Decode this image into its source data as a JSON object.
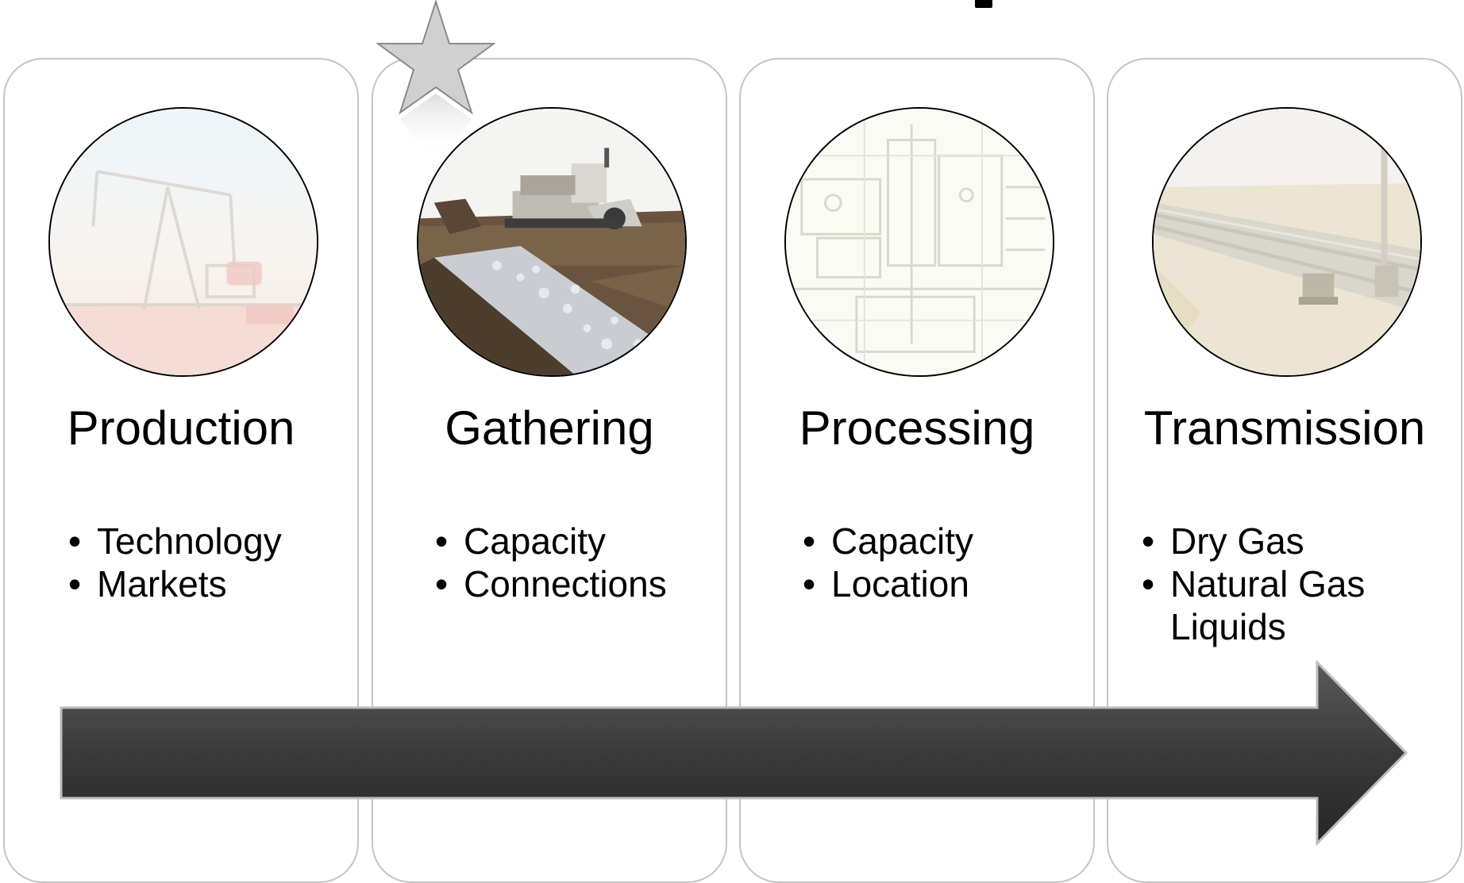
{
  "stages": [
    {
      "title": "Production",
      "bullets": [
        "Technology",
        "Markets"
      ],
      "image": "pumpjack-image",
      "faded": true
    },
    {
      "title": "Gathering",
      "bullets": [
        "Capacity",
        "Connections"
      ],
      "image": "trenching-machine-image",
      "faded": false
    },
    {
      "title": "Processing",
      "bullets": [
        "Capacity",
        "Location"
      ],
      "image": "blueprint-image",
      "faded": true
    },
    {
      "title": "Transmission",
      "bullets": [
        "Dry Gas",
        "Natural Gas Liquids"
      ],
      "image": "pipeline-construction-image",
      "faded": true
    }
  ],
  "highlight": {
    "stage_index": 1,
    "marker": "star-icon",
    "color": "#d0d0d0"
  },
  "colors": {
    "panel_border": "#c4c4c4",
    "arrow_dark": "#2e2e2e",
    "arrow_light": "#5a5a5a"
  }
}
